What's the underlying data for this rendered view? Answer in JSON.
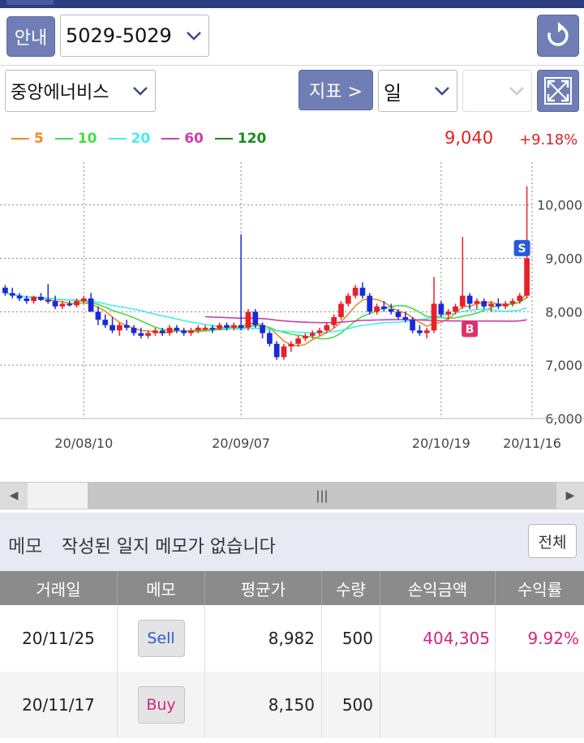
{
  "header": {
    "guide_label": "안내",
    "account": "5029-5029",
    "stock_name": "중앙에너비스",
    "indicator_label": "지표 >",
    "period": "일",
    "period_extra": ""
  },
  "legend": [
    {
      "label": "5",
      "color": "#f08a24"
    },
    {
      "label": "10",
      "color": "#44dd44"
    },
    {
      "label": "20",
      "color": "#44eeee"
    },
    {
      "label": "60",
      "color": "#d03cb0"
    },
    {
      "label": "120",
      "color": "#1a8a1a"
    }
  ],
  "quote": {
    "price": "9,040",
    "change": "+9.18%"
  },
  "chart_data": {
    "type": "candlestick",
    "y_ticks": [
      "10,000",
      "9,000",
      "8,000",
      "7,000",
      "6,000"
    ],
    "ylim": [
      6000,
      10800
    ],
    "x_labels": [
      "20/08/10",
      "20/09/07",
      "20/10/19",
      "20/11/16"
    ],
    "markers": [
      {
        "label": "S",
        "color": "#2a5bd7",
        "value": 9100
      },
      {
        "label": "B",
        "color": "#e0306a",
        "value": 7800
      }
    ],
    "candles": [
      [
        8450,
        8500,
        8300,
        8350
      ],
      [
        8350,
        8450,
        8250,
        8300
      ],
      [
        8300,
        8350,
        8200,
        8250
      ],
      [
        8250,
        8300,
        8150,
        8200
      ],
      [
        8200,
        8300,
        8150,
        8280
      ],
      [
        8280,
        8350,
        8200,
        8220
      ],
      [
        8220,
        8520,
        8150,
        8200
      ],
      [
        8200,
        8300,
        8050,
        8100
      ],
      [
        8100,
        8200,
        8050,
        8150
      ],
      [
        8150,
        8200,
        8100,
        8120
      ],
      [
        8120,
        8250,
        8080,
        8200
      ],
      [
        8200,
        8300,
        8150,
        8250
      ],
      [
        8250,
        8350,
        8050,
        8000
      ],
      [
        8000,
        8100,
        7750,
        7850
      ],
      [
        7850,
        7950,
        7700,
        7750
      ],
      [
        7750,
        7900,
        7600,
        7650
      ],
      [
        7650,
        7800,
        7550,
        7750
      ],
      [
        7750,
        7850,
        7650,
        7700
      ],
      [
        7700,
        7750,
        7550,
        7600
      ],
      [
        7600,
        7700,
        7500,
        7550
      ],
      [
        7550,
        7650,
        7500,
        7600
      ],
      [
        7600,
        7700,
        7550,
        7650
      ],
      [
        7650,
        7700,
        7550,
        7600
      ],
      [
        7600,
        7750,
        7550,
        7700
      ],
      [
        7700,
        7750,
        7600,
        7650
      ],
      [
        7650,
        7700,
        7550,
        7600
      ],
      [
        7600,
        7700,
        7550,
        7650
      ],
      [
        7650,
        7750,
        7600,
        7700
      ],
      [
        7700,
        7750,
        7650,
        7700
      ],
      [
        7700,
        7750,
        7600,
        7680
      ],
      [
        7680,
        7800,
        7650,
        7750
      ],
      [
        7750,
        7800,
        7650,
        7700
      ],
      [
        7700,
        7800,
        7650,
        7750
      ],
      [
        7750,
        9450,
        7650,
        7700
      ],
      [
        7700,
        8050,
        7650,
        8000
      ],
      [
        8000,
        8050,
        7700,
        7750
      ],
      [
        7750,
        7800,
        7500,
        7600
      ],
      [
        7600,
        7650,
        7350,
        7400
      ],
      [
        7400,
        7450,
        7100,
        7150
      ],
      [
        7150,
        7400,
        7100,
        7350
      ],
      [
        7350,
        7450,
        7250,
        7400
      ],
      [
        7400,
        7550,
        7350,
        7500
      ],
      [
        7500,
        7600,
        7450,
        7550
      ],
      [
        7550,
        7650,
        7500,
        7600
      ],
      [
        7600,
        7700,
        7550,
        7650
      ],
      [
        7650,
        7800,
        7600,
        7750
      ],
      [
        7750,
        7950,
        7700,
        7900
      ],
      [
        7900,
        8200,
        7850,
        8150
      ],
      [
        8150,
        8350,
        8100,
        8300
      ],
      [
        8300,
        8500,
        8250,
        8450
      ],
      [
        8450,
        8550,
        8250,
        8300
      ],
      [
        8300,
        8350,
        7950,
        8000
      ],
      [
        8000,
        8150,
        7950,
        8100
      ],
      [
        8100,
        8200,
        8000,
        8050
      ],
      [
        8050,
        8150,
        7950,
        8000
      ],
      [
        8000,
        8050,
        7850,
        7900
      ],
      [
        7900,
        8000,
        7800,
        7850
      ],
      [
        7850,
        7900,
        7600,
        7650
      ],
      [
        7650,
        7750,
        7550,
        7600
      ],
      [
        7600,
        7700,
        7500,
        7650
      ],
      [
        7650,
        8650,
        7600,
        8150
      ],
      [
        8150,
        8200,
        7900,
        7950
      ],
      [
        7950,
        8050,
        7850,
        8000
      ],
      [
        8000,
        8150,
        7950,
        8100
      ],
      [
        8100,
        9400,
        8050,
        8300
      ],
      [
        8300,
        8350,
        8050,
        8150
      ],
      [
        8150,
        8250,
        8050,
        8200
      ],
      [
        8200,
        8250,
        8050,
        8100
      ],
      [
        8100,
        8200,
        8000,
        8150
      ],
      [
        8150,
        8250,
        8050,
        8100
      ],
      [
        8100,
        8200,
        8050,
        8150
      ],
      [
        8150,
        8250,
        8100,
        8200
      ],
      [
        8200,
        8350,
        8150,
        8300
      ],
      [
        8300,
        10350,
        8250,
        9000
      ]
    ]
  },
  "memo": {
    "title": "메모",
    "message": "작성된 일지 메모가 없습니다",
    "all_button": "전체"
  },
  "table": {
    "headers": [
      "거래일",
      "메모",
      "평균가",
      "수량",
      "손익금액",
      "수익률"
    ],
    "rows": [
      {
        "date": "20/11/25",
        "memo": "Sell",
        "avg": "8,982",
        "qty": "500",
        "pnl": "404,305",
        "rate": "9.92%"
      },
      {
        "date": "20/11/17",
        "memo": "Buy",
        "avg": "8,150",
        "qty": "500",
        "pnl": "",
        "rate": ""
      }
    ]
  }
}
